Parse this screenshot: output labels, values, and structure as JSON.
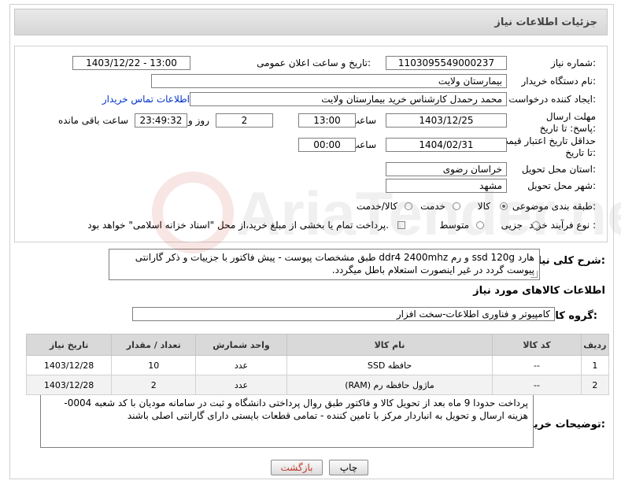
{
  "title": "جزئیات اطلاعات نیاز",
  "fields": {
    "need_number_label": "شماره نیاز:",
    "need_number": "1103095549000237",
    "announce_label": "تاریخ و ساعت اعلان عمومی:",
    "announce_value": "1403/12/22 - 13:00",
    "buyer_org_label": "نام دستگاه خریدار:",
    "buyer_org": "بیمارستان ولایت",
    "requester_label": "ایجاد کننده درخواست:",
    "requester": "محمد رحمدل کارشناس خرید بیمارستان ولایت",
    "contact_link": "اطلاعات تماس خریدار",
    "reply_deadline_label": "مهلت ارسال پاسخ: تا تاریخ:",
    "reply_date": "1403/12/25",
    "time_label": "ساعت",
    "reply_time": "13:00",
    "reply_days": "2",
    "days_label": "روز و",
    "remaining_time": "23:49:32",
    "remaining_label": "ساعت باقی مانده",
    "validity_label": "حداقل تاریخ اعتبار قیمت: تا تاریخ:",
    "validity_date": "1404/02/31",
    "validity_time_label": "ساعت",
    "validity_time": "00:00",
    "province_label": "استان محل تحویل:",
    "province": "خراسان رضوی",
    "city_label": "شهر محل تحویل:",
    "city": "مشهد",
    "category_label": "طبقه بندی موضوعی:",
    "category_options": [
      "کالا",
      "خدمت",
      "کالا/خدمت"
    ],
    "process_label": "نوع فرآیند خرید :",
    "process_options": [
      "جزیی",
      "متوسط"
    ],
    "payment_note": "پرداخت تمام یا بخشی از مبلغ خرید،از محل \"اسناد خزانه اسلامی\" خواهد بود."
  },
  "description": {
    "label": "شرح کلی نیاز:",
    "text": "هارد ssd 120g  و رم ddr4 2400mhz  طبق مشخصات پیوست - پیش فاکتور با جزییات و ذکر گارانتی پیوست گردد در غیر اینصورت استعلام باطل میگردد."
  },
  "goods": {
    "section_title": "اطلاعات کالاهای مورد نیاز",
    "group_label": "گروه کالا:",
    "group_value": "کامپیوتر و فناوری اطلاعات-سخت افزار",
    "headers": [
      "ردیف",
      "کد کالا",
      "نام کالا",
      "واحد شمارش",
      "تعداد / مقدار",
      "تاریخ نیاز"
    ],
    "rows": [
      [
        "1",
        "--",
        "حافظه SSD",
        "عدد",
        "10",
        "1403/12/28"
      ],
      [
        "2",
        "--",
        "ماژول حافظه رم (RAM)",
        "عدد",
        "2",
        "1403/12/28"
      ]
    ]
  },
  "buyer_notes": {
    "label": "توضیحات خریدار:",
    "text": "پرداخت حدودا 9 ماه بعد از تحویل کالا و فاکتور طبق روال پرداختی دانشگاه و ثبت در سامانه مودیان با کد شعبه 0004-هزینه ارسال و تحویل به انباردار مرکز با تامین کننده  - تمامی قطعات بایستی دارای گارانتی اصلی باشند"
  },
  "buttons": {
    "print": "چاپ",
    "back": "بازگشت"
  },
  "watermark": "AriaTender.neT"
}
